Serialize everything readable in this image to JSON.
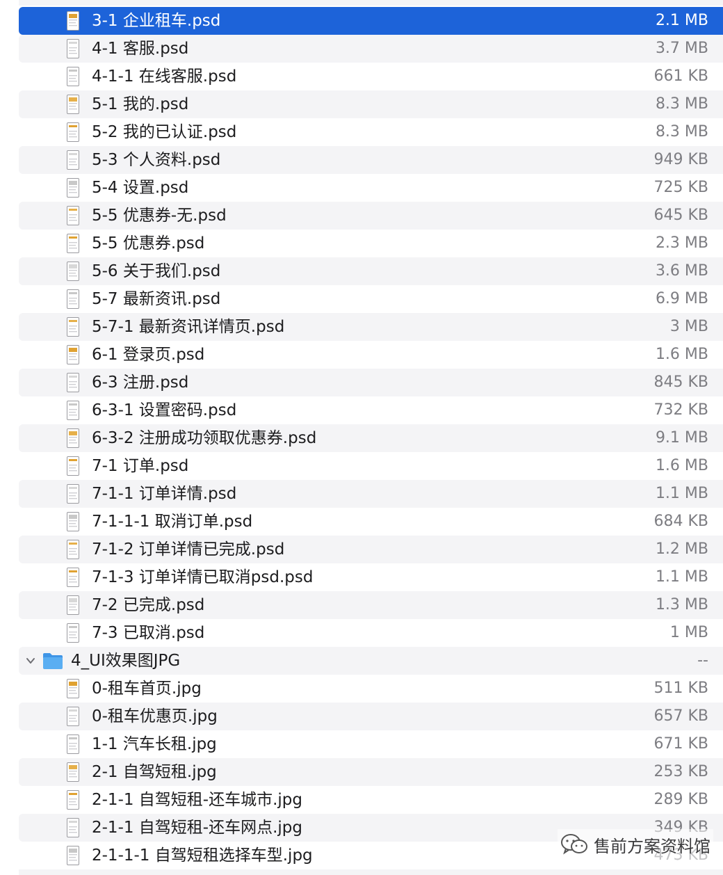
{
  "colors": {
    "selection": "#1d63d9",
    "stripe": "#f4f4f6",
    "name_text": "#1c1c1e",
    "size_text": "#7d7d82",
    "folder": "#5aaef2"
  },
  "rows": [
    {
      "name": "3-1 企业租车.psd",
      "size": "2.1 MB",
      "icon": "psd-file-icon",
      "selected": true
    },
    {
      "name": "4-1 客服.psd",
      "size": "3.7 MB",
      "icon": "psd-file-icon"
    },
    {
      "name": "4-1-1 在线客服.psd",
      "size": "661 KB",
      "icon": "psd-file-icon"
    },
    {
      "name": "5-1 我的.psd",
      "size": "8.3 MB",
      "icon": "psd-file-icon"
    },
    {
      "name": "5-2 我的已认证.psd",
      "size": "8.3 MB",
      "icon": "psd-file-icon"
    },
    {
      "name": "5-3 个人资料.psd",
      "size": "949 KB",
      "icon": "psd-file-icon"
    },
    {
      "name": "5-4 设置.psd",
      "size": "725 KB",
      "icon": "psd-file-icon"
    },
    {
      "name": "5-5 优惠券-无.psd",
      "size": "645 KB",
      "icon": "psd-file-icon"
    },
    {
      "name": "5-5 优惠券.psd",
      "size": "2.3 MB",
      "icon": "psd-file-icon"
    },
    {
      "name": "5-6 关于我们.psd",
      "size": "3.6 MB",
      "icon": "psd-file-icon"
    },
    {
      "name": "5-7 最新资讯.psd",
      "size": "6.9 MB",
      "icon": "psd-file-icon"
    },
    {
      "name": "5-7-1 最新资讯详情页.psd",
      "size": "3 MB",
      "icon": "psd-file-icon"
    },
    {
      "name": "6-1 登录页.psd",
      "size": "1.6 MB",
      "icon": "psd-file-icon"
    },
    {
      "name": "6-3 注册.psd",
      "size": "845 KB",
      "icon": "psd-file-icon"
    },
    {
      "name": "6-3-1 设置密码.psd",
      "size": "732 KB",
      "icon": "psd-file-icon"
    },
    {
      "name": "6-3-2 注册成功领取优惠券.psd",
      "size": "9.1 MB",
      "icon": "psd-file-icon"
    },
    {
      "name": "7-1 订单.psd",
      "size": "1.6 MB",
      "icon": "psd-file-icon"
    },
    {
      "name": "7-1-1 订单详情.psd",
      "size": "1.1 MB",
      "icon": "psd-file-icon"
    },
    {
      "name": "7-1-1-1 取消订单.psd",
      "size": "684 KB",
      "icon": "psd-file-icon"
    },
    {
      "name": "7-1-2 订单详情已完成.psd",
      "size": "1.2 MB",
      "icon": "psd-file-icon"
    },
    {
      "name": "7-1-3 订单详情已取消psd.psd",
      "size": "1.1 MB",
      "icon": "psd-file-icon"
    },
    {
      "name": "7-2 已完成.psd",
      "size": "1.3 MB",
      "icon": "psd-file-icon"
    },
    {
      "name": "7-3 已取消.psd",
      "size": "1 MB",
      "icon": "psd-file-icon"
    },
    {
      "name": "4_UI效果图JPG",
      "size": "--",
      "icon": "folder-icon",
      "folder": true
    },
    {
      "name": "0-租车首页.jpg",
      "size": "511 KB",
      "icon": "jpg-file-icon"
    },
    {
      "name": "0-租车优惠页.jpg",
      "size": "657 KB",
      "icon": "jpg-file-icon"
    },
    {
      "name": "1-1 汽车长租.jpg",
      "size": "671 KB",
      "icon": "jpg-file-icon"
    },
    {
      "name": "2-1 自驾短租.jpg",
      "size": "253 KB",
      "icon": "jpg-file-icon"
    },
    {
      "name": "2-1-1 自驾短租-还车城市.jpg",
      "size": "289 KB",
      "icon": "jpg-file-icon"
    },
    {
      "name": "2-1-1 自驾短租-还车网点.jpg",
      "size": "349 KB",
      "icon": "jpg-file-icon"
    },
    {
      "name": "2-1-1-1 自驾短租选择车型.jpg",
      "size": "473 KB",
      "icon": "jpg-file-icon"
    }
  ],
  "watermark": {
    "text": "售前方案资料馆",
    "icon": "wechat-icon"
  }
}
